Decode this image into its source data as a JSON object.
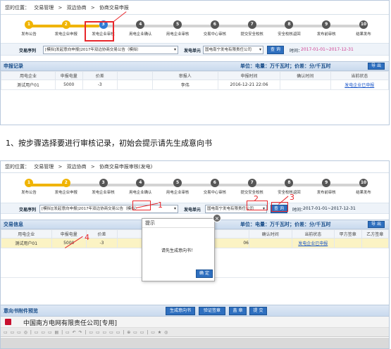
{
  "top": {
    "breadcrumb": {
      "location_label": "您的位置：",
      "crumbs": [
        "交易管理",
        ">",
        "双边协商",
        ">",
        "协商交易申报"
      ]
    },
    "steps": [
      {
        "num": "1",
        "label": "发布公告",
        "state": "done"
      },
      {
        "num": "2",
        "label": "发电企业申报",
        "state": "done"
      },
      {
        "num": "3",
        "label": "发电企业审核",
        "state": "cur"
      },
      {
        "num": "4",
        "label": "用电企业确认",
        "state": ""
      },
      {
        "num": "5",
        "label": "用电企业审核",
        "state": ""
      },
      {
        "num": "6",
        "label": "交易中心审核",
        "state": ""
      },
      {
        "num": "7",
        "label": "提交安全校核",
        "state": ""
      },
      {
        "num": "8",
        "label": "安全校核返回",
        "state": ""
      },
      {
        "num": "9",
        "label": "发布前审核",
        "state": ""
      },
      {
        "num": "10",
        "label": "结果发布",
        "state": ""
      }
    ],
    "filter": {
      "sequence_label": "交易序列",
      "sequence_value": "[模拟]发起意向申报]2017年双边协商交易公告（模拟）",
      "unit_label": "发电单元",
      "unit_value": "国电南宁发电有限责任公司",
      "query_label": "查 询",
      "time_label": "时间：",
      "time_value": "2017-01-01~2017-12-31"
    },
    "section_title": "申报记录",
    "unit_text": "单位：电量：万千瓦时；价差：分/千瓦时",
    "export_label": "导 出",
    "columns": [
      "用电企业",
      "申报电量",
      "价差",
      "",
      "审报人",
      "申报时间",
      "确认时间",
      "当前状态"
    ],
    "rows": [
      {
        "company": "测试用户01",
        "energy": "5000",
        "diff": "-3",
        "blank": "",
        "user": "李伟",
        "time": "2016-12-21 22:06",
        "confirm": "",
        "status": "发电企业已申报"
      }
    ]
  },
  "caption": "1、按步骤选择要进行审核记录，初始会提示请先生成意向书",
  "bottom": {
    "breadcrumb": {
      "location_label": "您的位置：",
      "crumbs": [
        "交易管理",
        ">",
        "双边协商",
        ">",
        "协商交易申报审核(发电)"
      ]
    },
    "steps": [
      {
        "num": "1",
        "label": "发布公告",
        "state": "done"
      },
      {
        "num": "2",
        "label": "发电企业申报",
        "state": "done"
      },
      {
        "num": "3",
        "label": "发电企业审核",
        "state": ""
      },
      {
        "num": "4",
        "label": "用电企业确认",
        "state": ""
      },
      {
        "num": "5",
        "label": "用电企业审核",
        "state": ""
      },
      {
        "num": "6",
        "label": "交易中心审核",
        "state": ""
      },
      {
        "num": "7",
        "label": "提交安全校核",
        "state": ""
      },
      {
        "num": "8",
        "label": "安全校核返回",
        "state": ""
      },
      {
        "num": "9",
        "label": "发布前审核",
        "state": ""
      },
      {
        "num": "10",
        "label": "结果发布",
        "state": ""
      }
    ],
    "filter": {
      "sequence_label": "交易序列",
      "sequence_value": "[模拟][发起意向申报]2017年双边协商交易公告（模拟）",
      "unit_label": "发电单元",
      "unit_value": "国电南宁发电有限责任公司",
      "query_label": "查 询",
      "time_label": "时间：",
      "time_value": "2017-01-01~2017-12-31"
    },
    "section_title": "交易信息",
    "unit_text": "单位：电量：万千瓦时；价差：分/千瓦时",
    "export_label": "导 出",
    "columns": [
      "用电企业",
      "申报电量",
      "价差",
      "",
      "",
      "确认时间",
      "当前状态",
      "甲方签章",
      "乙方签章"
    ],
    "rows": [
      {
        "company": "测试用户01",
        "energy": "5000",
        "diff": "-3",
        "c4": "",
        "c5": "06",
        "confirm": "",
        "status": "发电企业已申报",
        "sigA": "",
        "sigB": ""
      }
    ],
    "dialog": {
      "title": "提示",
      "message": "请先生成意向书！",
      "ok_label": "确 定",
      "close": "×"
    },
    "annotations": [
      "1",
      "2",
      "3",
      "4"
    ],
    "preview": {
      "title": "意向书附件预览",
      "gen_label": "生成意向书",
      "verify_label": "验证签章",
      "stamp_label": "盖 章",
      "submit_label": "提 交",
      "doc_title": "中国南方电网有限责任公司[专用]",
      "toolbar_text": "▭ ▭ ▭ ◎ | ▭ ▭ ▭ ▤ | ▭ ↶ ↷ | ▭ ▭ ▭ ▭ ▭ | ⊕ ▭ ▭ | ▭ ★ ◎"
    }
  },
  "colors": {
    "accent": "#2e6fbf",
    "done": "#f0b400",
    "annotation": "#e8262b",
    "selected_row": "#fbf3c4"
  }
}
